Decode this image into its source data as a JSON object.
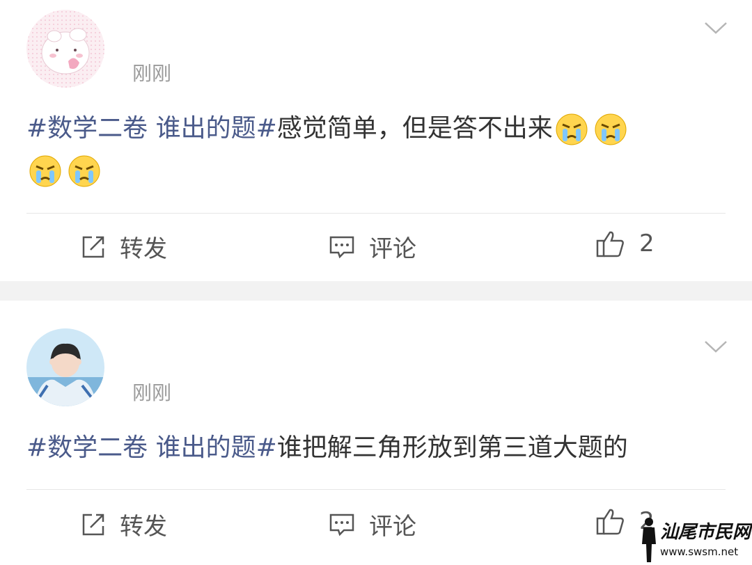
{
  "posts": [
    {
      "time": "刚刚",
      "text": {
        "tag": "#数学二卷 谁出的题#",
        "body": "感觉简单，但是答不出来"
      },
      "emoji_name": "crying-face-icon",
      "actions": {
        "repost_label": "转发",
        "comment_label": "评论",
        "like_count": "2"
      }
    },
    {
      "time": "刚刚",
      "text": {
        "tag": "#数学二卷 谁出的题#",
        "body": "谁把解三角形放到第三道大题的"
      },
      "actions": {
        "repost_label": "转发",
        "comment_label": "评论",
        "like_count": "2"
      }
    }
  ],
  "watermark": {
    "title": "汕尾市民网",
    "url": "www.swsm.net"
  },
  "colors": {
    "tag": "#4a5a8a",
    "text": "#333333",
    "meta": "#9a9a9a",
    "separator": "#f2f2f2"
  }
}
